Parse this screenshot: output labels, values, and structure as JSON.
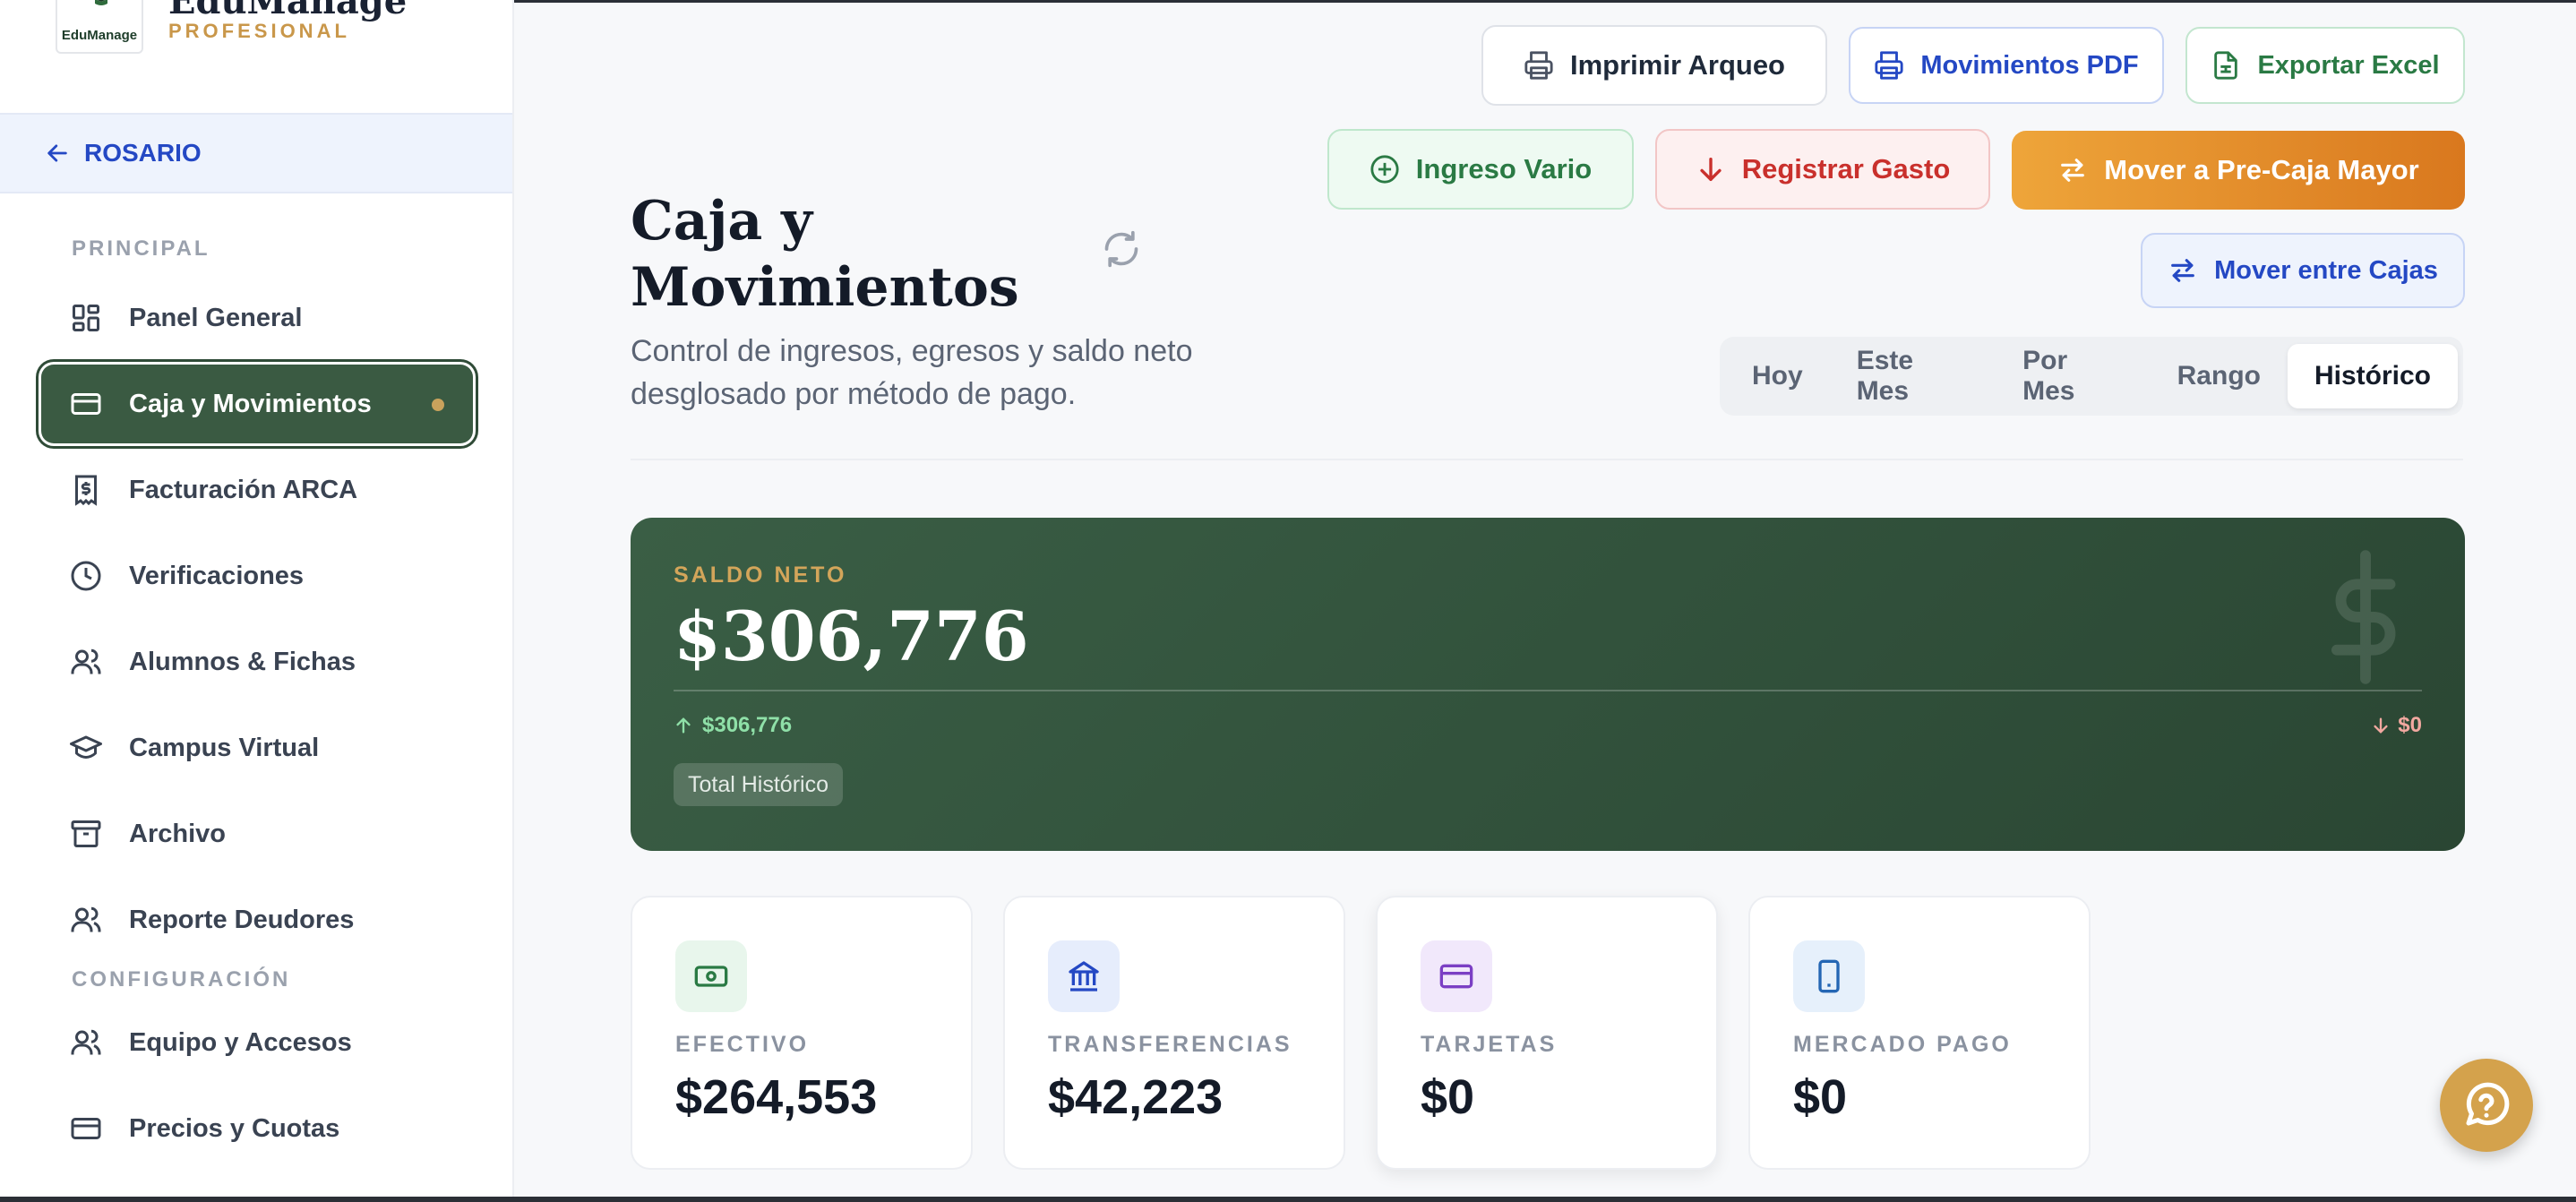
{
  "brand": {
    "logo_text": "EduManage",
    "name": "EduManage",
    "tier": "PROFESIONAL"
  },
  "branch": {
    "label": "ROSARIO"
  },
  "sidebar": {
    "section_principal": "PRINCIPAL",
    "section_config": "CONFIGURACIÓN",
    "items": [
      {
        "label": "Panel General",
        "icon": "grid-icon"
      },
      {
        "label": "Caja y Movimientos",
        "icon": "card-icon",
        "active": true
      },
      {
        "label": "Facturación ARCA",
        "icon": "invoice-dollar-icon"
      },
      {
        "label": "Verificaciones",
        "icon": "clock-icon"
      },
      {
        "label": "Alumnos & Fichas",
        "icon": "users-icon"
      },
      {
        "label": "Campus Virtual",
        "icon": "graduation-cap-icon"
      },
      {
        "label": "Archivo",
        "icon": "archive-icon"
      },
      {
        "label": "Reporte Deudores",
        "icon": "users-icon"
      }
    ],
    "config_items": [
      {
        "label": "Equipo y Accesos",
        "icon": "users-icon"
      },
      {
        "label": "Precios y Cuotas",
        "icon": "card-icon"
      }
    ]
  },
  "toolbar": {
    "print_arqueo": "Imprimir Arqueo",
    "movimientos_pdf": "Movimientos PDF",
    "export_excel": "Exportar Excel",
    "ingreso_vario": "Ingreso Vario",
    "registrar_gasto": "Registrar Gasto",
    "mover_precaja": "Mover a Pre-Caja Mayor",
    "mover_cajas": "Mover entre Cajas"
  },
  "header": {
    "title": "Caja y Movimientos",
    "subtitle": "Control de ingresos, egresos y saldo neto desglosado por método de pago."
  },
  "tabs": [
    "Hoy",
    "Este Mes",
    "Por Mes",
    "Rango",
    "Histórico"
  ],
  "active_tab": "Histórico",
  "saldo": {
    "label": "SALDO NETO",
    "amount": "$306,776",
    "ingresos": "$306,776",
    "egresos": "$0",
    "chip": "Total Histórico"
  },
  "methods": [
    {
      "label": "EFECTIVO",
      "value": "$264,553",
      "icon": "cash-icon",
      "color": "#2a7a44",
      "bg": "#e8f6ec"
    },
    {
      "label": "TRANSFERENCIAS",
      "value": "$42,223",
      "icon": "bank-icon",
      "color": "#2448c4",
      "bg": "#e6edfc"
    },
    {
      "label": "TARJETAS",
      "value": "$0",
      "icon": "card-icon",
      "color": "#7b3fc4",
      "bg": "#f1e8fb"
    },
    {
      "label": "MERCADO PAGO",
      "value": "$0",
      "icon": "phone-icon",
      "color": "#2466b4",
      "bg": "#e6f0fb"
    }
  ],
  "colors": {
    "primary_green": "#3a5a42",
    "accent_gold": "#c9a25c",
    "accent_blue": "#2448c4",
    "danger": "#c9302c",
    "orange": "#e08a28"
  }
}
